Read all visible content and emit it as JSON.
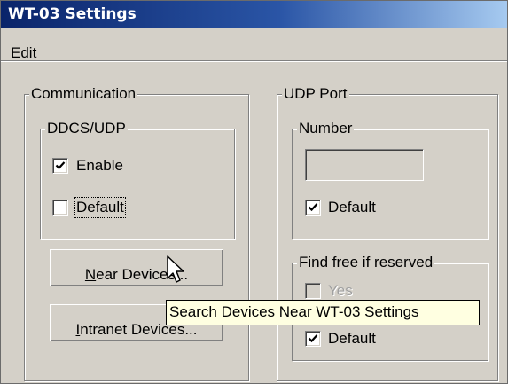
{
  "window": {
    "title": "WT-03 Settings"
  },
  "menu": {
    "edit_key": "E",
    "edit_rest": "dit"
  },
  "communication": {
    "legend": "Communication",
    "ddcs_udp": {
      "legend": "DDCS/UDP",
      "enable": {
        "label": "Enable",
        "checked": true
      },
      "default": {
        "label": "Default",
        "checked": false
      }
    },
    "near_button": {
      "key": "N",
      "rest": "ear Devices..."
    },
    "intranet_button": {
      "key": "I",
      "rest": "ntranet Devices..."
    }
  },
  "udp_port": {
    "legend": "UDP Port",
    "number": {
      "legend": "Number",
      "value": "",
      "default": {
        "label": "Default",
        "checked": true
      }
    },
    "find_free": {
      "legend": "Find free if reserved",
      "yes": {
        "label": "Yes",
        "checked": false,
        "enabled": false
      },
      "default": {
        "label": "Default",
        "checked": true
      }
    }
  },
  "tooltip": {
    "text": "Search Devices Near WT-03 Settings"
  },
  "icons": {
    "check": "check-icon",
    "cursor": "arrow-cursor-icon"
  },
  "colors": {
    "face": "#d4d0c8",
    "title_start": "#0a246a",
    "title_end": "#a6caf0",
    "tooltip_bg": "#ffffe1"
  }
}
